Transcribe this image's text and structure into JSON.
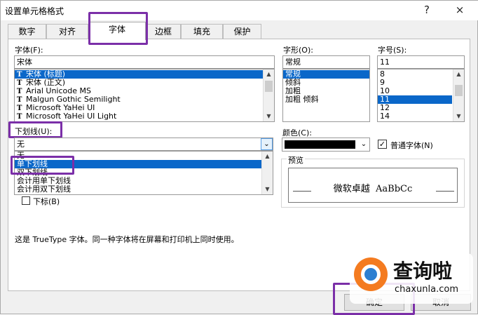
{
  "window": {
    "title": "设置单元格格式",
    "help": "?",
    "close": "×"
  },
  "tabs": [
    {
      "label": "数字"
    },
    {
      "label": "对齐"
    },
    {
      "label": "字体"
    },
    {
      "label": "边框"
    },
    {
      "label": "填充"
    },
    {
      "label": "保护"
    }
  ],
  "font": {
    "label": "字体(F):",
    "value": "宋体",
    "items": [
      {
        "label": "宋体 (标题)",
        "selected": true
      },
      {
        "label": "宋体 (正文)"
      },
      {
        "label": "Arial Unicode MS"
      },
      {
        "label": "Malgun Gothic Semilight"
      },
      {
        "label": "Microsoft YaHei UI"
      },
      {
        "label": "Microsoft YaHei UI Light"
      }
    ],
    "icon": "truetype-icon"
  },
  "style": {
    "label": "字形(O):",
    "value": "常规",
    "items": [
      "常规",
      "倾斜",
      "加粗",
      "加粗 倾斜"
    ]
  },
  "size": {
    "label": "字号(S):",
    "value": "11",
    "items": [
      "8",
      "9",
      "10",
      "11",
      "12",
      "14"
    ]
  },
  "underline": {
    "label": "下划线(U):",
    "value": "无",
    "options": [
      "无",
      "单下划线",
      "双下划线",
      "会计用单下划线",
      "会计用双下划线"
    ]
  },
  "color": {
    "label": "颜色(C):",
    "swatch": "#000000"
  },
  "normal_font": {
    "label": "普通字体(N)",
    "checked": true
  },
  "effects": {
    "subscript": "下标(B)"
  },
  "preview": {
    "label": "预览",
    "text": "微软卓越  AaBbCc"
  },
  "note": "这是 TrueType 字体。同一种字体将在屏幕和打印机上同时使用。",
  "buttons": {
    "ok": "确定",
    "cancel": "取消"
  },
  "watermark": {
    "brand": "查询啦",
    "url": "chaxunla.com"
  }
}
